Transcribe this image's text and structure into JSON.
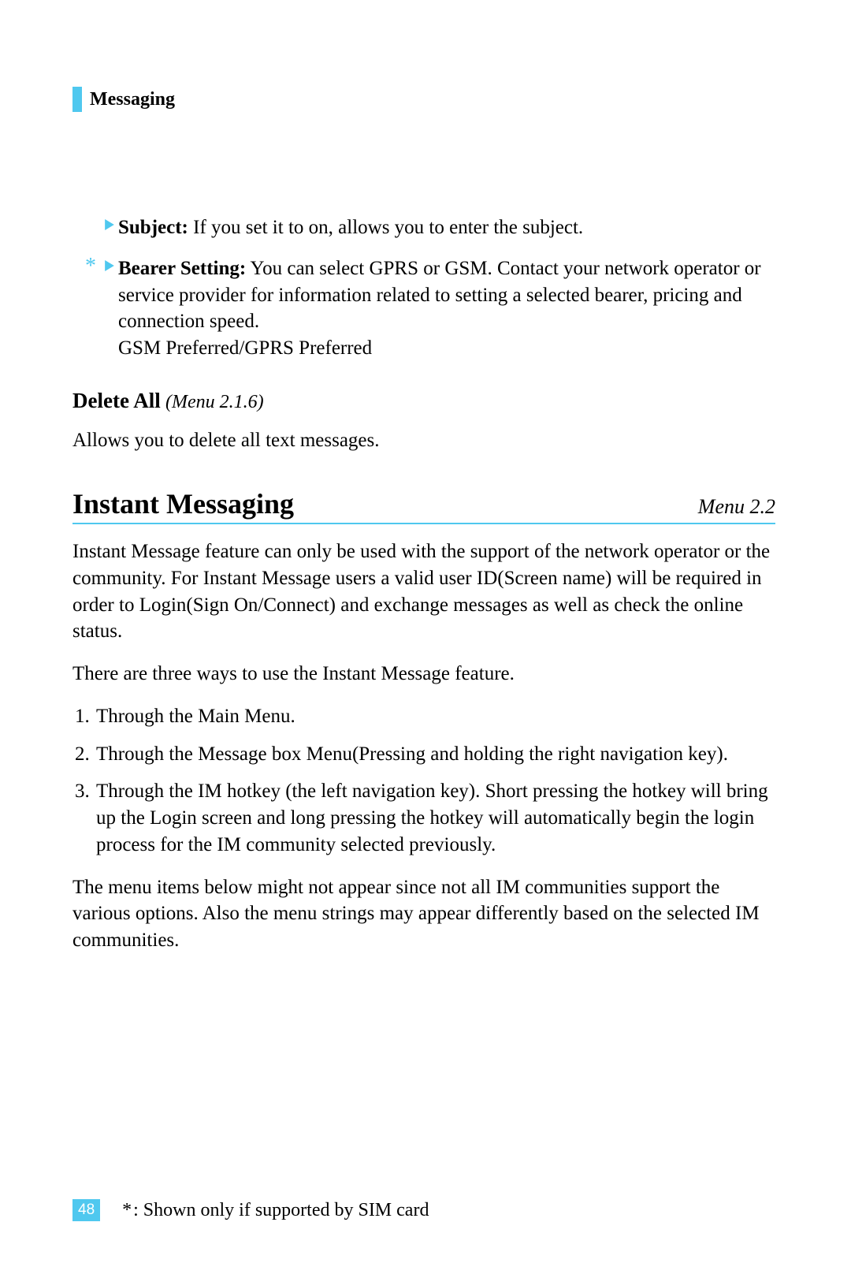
{
  "header": {
    "section": "Messaging"
  },
  "bullets": [
    {
      "asterisk": false,
      "label": "Subject:",
      "text": " If you set it to on, allows you to enter the subject."
    },
    {
      "asterisk": true,
      "label": "Bearer Setting:",
      "text": " You can select GPRS or GSM. Contact your network operator or service provider for information related to setting a selected bearer, pricing and connection speed.",
      "line2": "GSM Preferred/GPRS Preferred"
    }
  ],
  "deleteAll": {
    "title": "Delete All",
    "menu": "(Menu 2.1.6)",
    "desc": "Allows you to delete all text messages."
  },
  "im": {
    "title": "Instant Messaging",
    "menu": "Menu 2.2",
    "para1": "Instant Message feature can only be used with the support of the network operator or the community. For Instant Message users a valid user ID(Screen name) will be required in order to Login(Sign On/Connect) and exchange messages as well as check the online status.",
    "para2": "There are three ways to use the Instant Message feature.",
    "list": [
      "Through the Main Menu.",
      "Through the Message box Menu(Pressing and holding the right navigation key).",
      "Through the IM hotkey (the left navigation key). Short pressing the hotkey will bring up the Login screen and long pressing the hotkey will automatically begin the login process for the IM community selected previously."
    ],
    "para3": "The menu items below might not appear since not all IM communities support the various options. Also the menu strings may appear differently based on the selected IM communities."
  },
  "footer": {
    "page": "48",
    "noteSymbol": "*",
    "noteText": ": Shown only if supported by SIM card"
  }
}
